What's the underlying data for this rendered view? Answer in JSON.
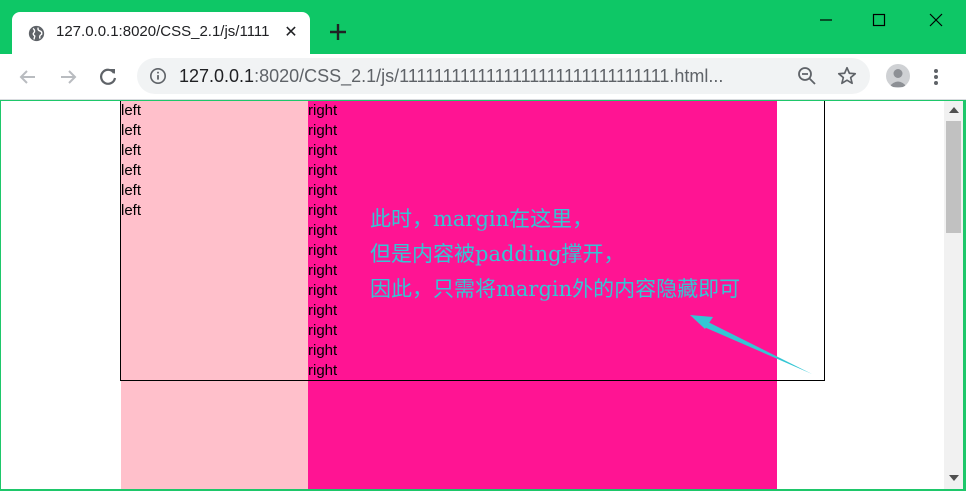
{
  "tab": {
    "title": "127.0.0.1:8020/CSS_2.1/js/1111",
    "close_glyph": "✕",
    "globe_icon": "globe-icon"
  },
  "window_controls": [
    "minimize-icon",
    "maximize-icon",
    "close-icon"
  ],
  "toolbar": {
    "url_host": "127.0.0.1",
    "url_rest": ":8020/CSS_2.1/js/1111111111111111111111111111111.html...",
    "icons": [
      "back-arrow-icon",
      "forward-arrow-icon",
      "reload-icon",
      "info-icon",
      "zoom-out-icon",
      "star-icon",
      "avatar-icon",
      "menu-icon"
    ]
  },
  "page": {
    "left_label": "left",
    "left_count": 6,
    "right_label": "right",
    "right_count": 14,
    "annotation": [
      "此时，margin在这里，",
      "但是内容被padding撑开，",
      "因此，只需将margin外的内容隐藏即可"
    ],
    "colors": {
      "left_bg": "#ffc0cb",
      "right_bg": "#ff1493",
      "annotation": "#34c6d4",
      "chrome_green": "#0ec766"
    }
  }
}
